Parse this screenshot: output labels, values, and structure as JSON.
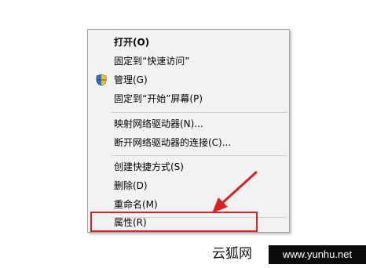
{
  "menu": {
    "items": [
      {
        "label": "打开(O)",
        "bold": true
      },
      {
        "label": "固定到“快速访问”"
      },
      {
        "label": "管理(G)",
        "icon": "uac-shield-icon"
      },
      {
        "label": "固定到“开始”屏幕(P)"
      },
      {
        "label": "映射网络驱动器(N)..."
      },
      {
        "label": "断开网络驱动器的连接(C)..."
      },
      {
        "label": "创建快捷方式(S)"
      },
      {
        "label": "删除(D)"
      },
      {
        "label": "重命名(M)"
      },
      {
        "label": "属性(R)",
        "highlighted": true
      }
    ]
  },
  "annotation": {
    "color": "#e02020"
  },
  "watermark": {
    "site_name": "云狐网",
    "url": "www.yunhu.net"
  }
}
